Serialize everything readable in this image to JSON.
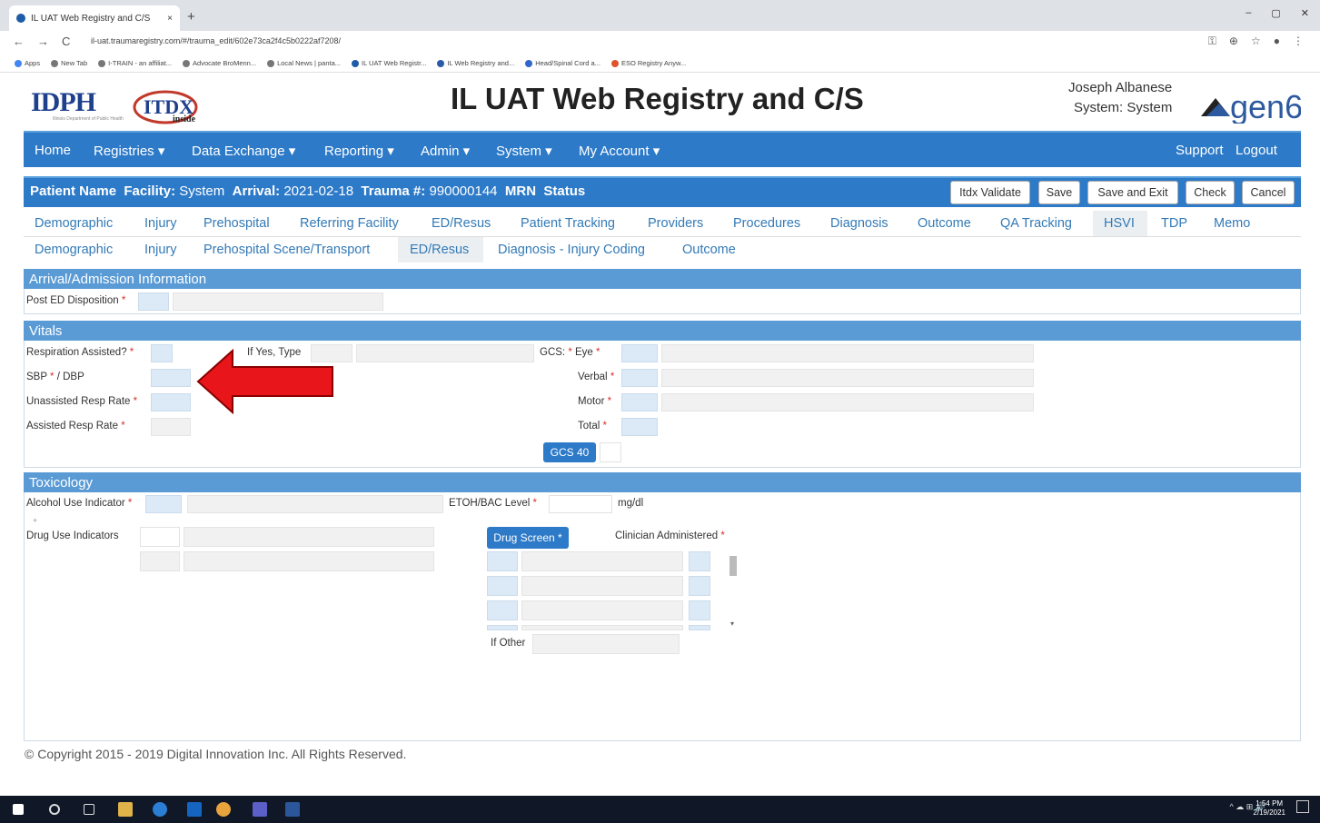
{
  "browser": {
    "tab_title": "IL UAT Web Registry and C/S",
    "tab_close": "×",
    "new_tab": "+",
    "url": "il-uat.traumaregistry.com/#/trauma_edit/602e73ca2f4c5b0222af7208/",
    "nav_back": "←",
    "nav_forward": "→",
    "nav_reload": "C",
    "window_controls": [
      "–",
      "▢",
      "✕"
    ],
    "bookmarks": [
      "Apps",
      "New Tab",
      "I-TRAIN - an affiliat...",
      "Advocate BroMenn...",
      "Local News | panta...",
      "IL UAT Web Registr...",
      "IL Web Registry and...",
      "Head/Spinal Cord a...",
      "ESO Registry Anyw..."
    ]
  },
  "header": {
    "logo_idph": "IDPH",
    "logo_idph_sub": "Illinois Department of Public Health",
    "logo_itdx": "ITDX",
    "logo_itdx_sub": "inside",
    "title": "IL UAT Web Registry and C/S",
    "user_name": "Joseph Albanese",
    "user_system": "System: System",
    "logo_gen6": "gen6"
  },
  "nav": {
    "home": "Home",
    "registries": "Registries ▾",
    "data_exchange": "Data Exchange ▾",
    "reporting": "Reporting ▾",
    "admin": "Admin ▾",
    "system": "System ▾",
    "my_account": "My Account ▾",
    "support": "Support",
    "logout": "Logout"
  },
  "patient_bar": {
    "patient_name": "Patient Name",
    "facility_label": "Facility:",
    "facility_value": "System",
    "arrival_label": "Arrival:",
    "arrival_value": "2021-02-18",
    "trauma_label": "Trauma #:",
    "trauma_value": "990000144",
    "mrn_label": "MRN",
    "status_label": "Status",
    "buttons": {
      "itdx_validate": "Itdx Validate",
      "save": "Save",
      "save_and_exit": "Save and Exit",
      "check": "Check",
      "cancel": "Cancel"
    }
  },
  "tabs_primary": [
    "Demographic",
    "Injury",
    "Prehospital",
    "Referring Facility",
    "ED/Resus",
    "Patient Tracking",
    "Providers",
    "Procedures",
    "Diagnosis",
    "Outcome",
    "QA Tracking",
    "HSVI",
    "TDP",
    "Memo"
  ],
  "tabs_secondary": [
    "Demographic",
    "Injury",
    "Prehospital Scene/Transport",
    "ED/Resus",
    "Diagnosis - Injury Coding",
    "Outcome"
  ],
  "arrival": {
    "heading": "Arrival/Admission Information",
    "post_ed_disposition": "Post ED Disposition"
  },
  "vitals": {
    "heading": "Vitals",
    "respiration_assisted": "Respiration Assisted?",
    "if_yes_type": "If Yes, Type",
    "gcs_label": "GCS:",
    "eye": "Eye",
    "sbp": "SBP",
    "dbp": "/ DBP",
    "verbal": "Verbal",
    "unassisted_resp_rate": "Unassisted Resp Rate",
    "motor": "Motor",
    "assisted_resp_rate": "Assisted Resp Rate",
    "total": "Total",
    "gcs40_button": "GCS 40"
  },
  "toxicology": {
    "heading": "Toxicology",
    "alcohol_use_indicator": "Alcohol Use Indicator",
    "etoh_bac_level": "ETOH/BAC Level",
    "unit": "mg/dl",
    "plus": "+",
    "drug_use_indicators": "Drug Use Indicators",
    "drug_screen_button": "Drug Screen",
    "clinician_administered": "Clinician Administered",
    "if_other": "If Other",
    "scroll_down": "▾"
  },
  "required_mark": "*",
  "footer": {
    "copyright": "© Copyright 2015 - 2019 Digital Innovation Inc. All Rights Reserved."
  },
  "taskbar": {
    "tray": "^ ☁ ⊞ 🔊",
    "time": "1:54 PM",
    "date": "2/19/2021"
  },
  "colors": {
    "nav_blue": "#2d7ac8",
    "panel_head": "#5b9bd5",
    "link": "#337ab7",
    "required": "#d9302c",
    "arrow_red": "#e8151b"
  }
}
